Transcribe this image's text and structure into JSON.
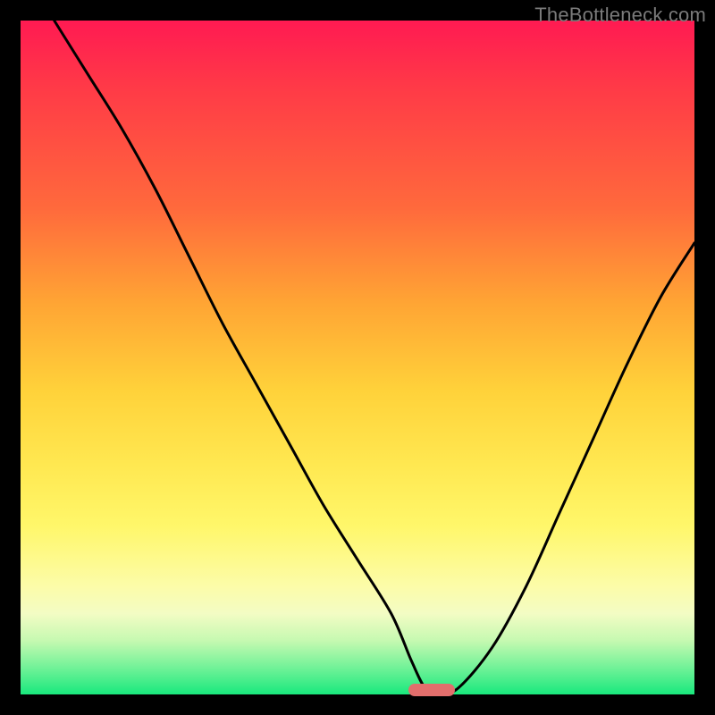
{
  "watermark": "TheBottleneck.com",
  "chart_data": {
    "type": "line",
    "title": "",
    "xlabel": "",
    "ylabel": "",
    "xlim": [
      0,
      100
    ],
    "ylim": [
      0,
      100
    ],
    "series": [
      {
        "name": "bottleneck-curve",
        "x": [
          5,
          10,
          15,
          20,
          25,
          30,
          35,
          40,
          45,
          50,
          55,
          58,
          60,
          62,
          65,
          70,
          75,
          80,
          85,
          90,
          95,
          100
        ],
        "values": [
          100,
          92,
          84,
          75,
          65,
          55,
          46,
          37,
          28,
          20,
          12,
          5,
          1,
          0,
          1,
          7,
          16,
          27,
          38,
          49,
          59,
          67
        ]
      }
    ],
    "legend": false,
    "grid": false,
    "annotations": [],
    "marker": {
      "x": 61,
      "y": 0,
      "width_pct": 7
    }
  },
  "colors": {
    "curve": "#000000",
    "marker": "#e26e6c",
    "frame": "#000000",
    "watermark": "#7a7a7a"
  }
}
